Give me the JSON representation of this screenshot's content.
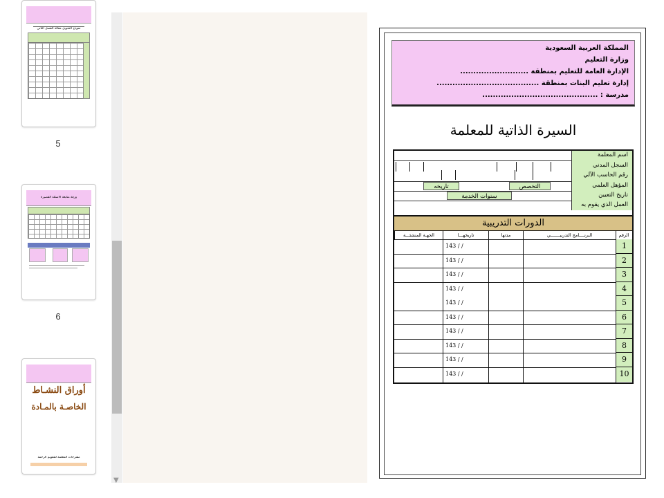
{
  "thumbnails": [
    {
      "number": "5",
      "title": "نموذج التحويل مقالة القصل الثاني",
      "selected": false
    },
    {
      "number": "6",
      "title": "ورقة متابعة الأسئلة القصيرة",
      "selected": false
    },
    {
      "number": "7",
      "title_line1": "أوراق النشـاط",
      "title_line2": "الخاصـة بالمـادة",
      "footer": "مقترحات المعلمة للتقويم الرحمة",
      "selected": false
    }
  ],
  "page": {
    "header_lines": [
      "المملكة العربية السعودية",
      "وزارة التعليم",
      "الإدارة العامة للتعليم بمنطقة ..........................",
      "إدارة تعليم البنات بمنطقة .......................................",
      "مدرسة : ............................................"
    ],
    "title": "السيرة الذاتية للمعلمة",
    "info_labels": {
      "teacher_name": "اسم المعلمة",
      "civil_record": "السجل المدني",
      "computer_number": "رقم الحاسب الآلي",
      "qualification": "المؤهل العلمي",
      "specialty": "التخصص",
      "its_date": "تاريخه",
      "hire_date": "تاريخ التعيين",
      "service_years": "سنوات الخدمة",
      "current_work": "العمل الذي يقوم به"
    },
    "courses_heading": "الدورات التدريبية",
    "columns": {
      "number": "الرقم",
      "program": "البرنــــامج التدريبـــــــي",
      "duration": "مدتها",
      "date": "تاريخهـــا",
      "issuer": "الجهـة المنشئـــة"
    },
    "rows": [
      {
        "num": "1",
        "date": "143  /   /"
      },
      {
        "num": "2",
        "date": "143  /   /"
      },
      {
        "num": "3",
        "date": "143  /   /"
      },
      {
        "num": "4",
        "date": "143  /   /"
      },
      {
        "num": "5",
        "date": "143  /   /"
      },
      {
        "num": "6",
        "date": "143  /   /"
      },
      {
        "num": "7",
        "date": "143  /   /"
      },
      {
        "num": "8",
        "date": "143  /   /"
      },
      {
        "num": "9",
        "date": "143  /   /"
      },
      {
        "num": "10",
        "date": "143  /   /"
      }
    ]
  },
  "colors": {
    "header_pink": "#f5c8f3",
    "label_green": "#d2eebd",
    "courses_tan": "#d8c187",
    "canvas_bg": "#f9f5f0"
  }
}
